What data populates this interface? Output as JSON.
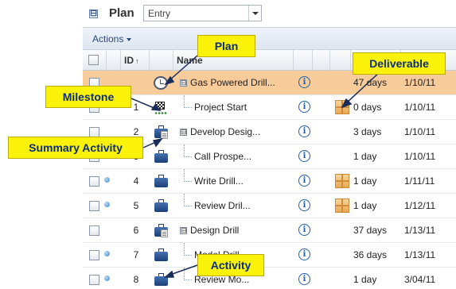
{
  "plan_bar": {
    "collapse_glyph": "⊟",
    "label": "Plan",
    "selector_value": "Entry"
  },
  "actions": {
    "label": "Actions"
  },
  "columns": {
    "id": "ID",
    "name": "Name"
  },
  "rows": [
    {
      "id": "",
      "icon": "plan-icon",
      "name": "Gas Powered Drill...",
      "expander": "⊟",
      "duration": "47 days",
      "start": "1/10/11",
      "deliverable": false,
      "dot": false,
      "highlight": true
    },
    {
      "id": "1",
      "icon": "milestone-flag-icon",
      "name": "Project Start",
      "expander": "",
      "duration": "0 days",
      "start": "1/10/11",
      "deliverable": true,
      "dot": false,
      "highlight": false
    },
    {
      "id": "2",
      "icon": "summary-activity-icon",
      "name": "Develop Desig...",
      "expander": "⊟",
      "duration": "3 days",
      "start": "1/10/11",
      "deliverable": false,
      "dot": false,
      "highlight": false
    },
    {
      "id": "3",
      "icon": "activity-icon",
      "name": "Call Prospe...",
      "expander": "",
      "duration": "1 day",
      "start": "1/10/11",
      "deliverable": false,
      "dot": false,
      "highlight": false
    },
    {
      "id": "4",
      "icon": "activity-icon",
      "name": "Write Drill...",
      "expander": "",
      "duration": "1 day",
      "start": "1/11/11",
      "deliverable": true,
      "dot": true,
      "highlight": false
    },
    {
      "id": "5",
      "icon": "activity-icon",
      "name": "Review Dril...",
      "expander": "",
      "duration": "1 day",
      "start": "1/12/11",
      "deliverable": true,
      "dot": true,
      "highlight": false
    },
    {
      "id": "6",
      "icon": "summary-activity-icon",
      "name": "Design Drill",
      "expander": "⊟",
      "duration": "37 days",
      "start": "1/13/11",
      "deliverable": false,
      "dot": false,
      "highlight": false
    },
    {
      "id": "7",
      "icon": "activity-icon",
      "name": "Model Drill",
      "expander": "",
      "duration": "36 days",
      "start": "1/13/11",
      "deliverable": false,
      "dot": true,
      "highlight": false
    },
    {
      "id": "8",
      "icon": "activity-icon",
      "name": "Review Mo...",
      "expander": "",
      "duration": "1 day",
      "start": "3/04/11",
      "deliverable": false,
      "dot": true,
      "highlight": false
    }
  ],
  "callouts": {
    "plan": "Plan",
    "deliverable": "Deliverable",
    "milestone": "Milestone",
    "summary_activity": "Summary Activity",
    "activity": "Activity"
  },
  "colors": {
    "callout_bg": "#fbf20a",
    "callout_text": "#0c2d7a",
    "highlight_row": "#f8cb9a"
  }
}
